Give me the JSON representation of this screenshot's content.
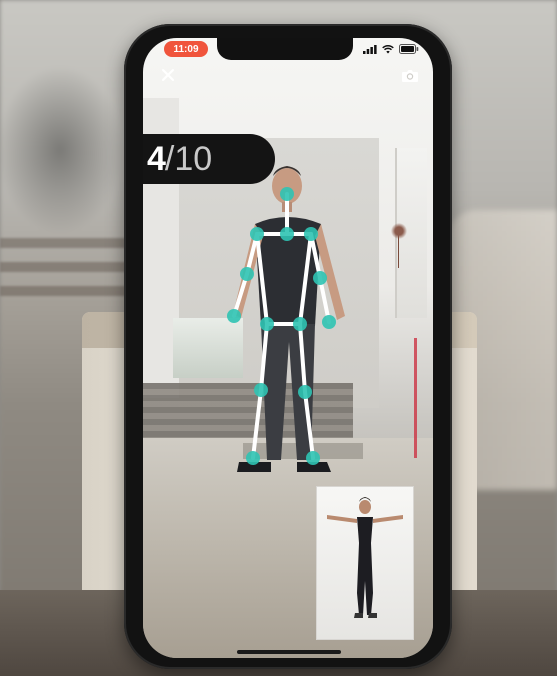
{
  "status_bar": {
    "time": "11:09"
  },
  "workout": {
    "current_rep": "4",
    "separator": "/",
    "total_reps": "10"
  },
  "icons": {
    "close": "close-icon",
    "camera": "camera-icon",
    "signal": "signal-icon",
    "wifi": "wifi-icon",
    "battery": "battery-icon"
  },
  "colors": {
    "time_pill": "#f0543c",
    "pose_joint": "#2fc3b3",
    "pose_bone": "#ffffff",
    "counter_bg": "#141414"
  }
}
